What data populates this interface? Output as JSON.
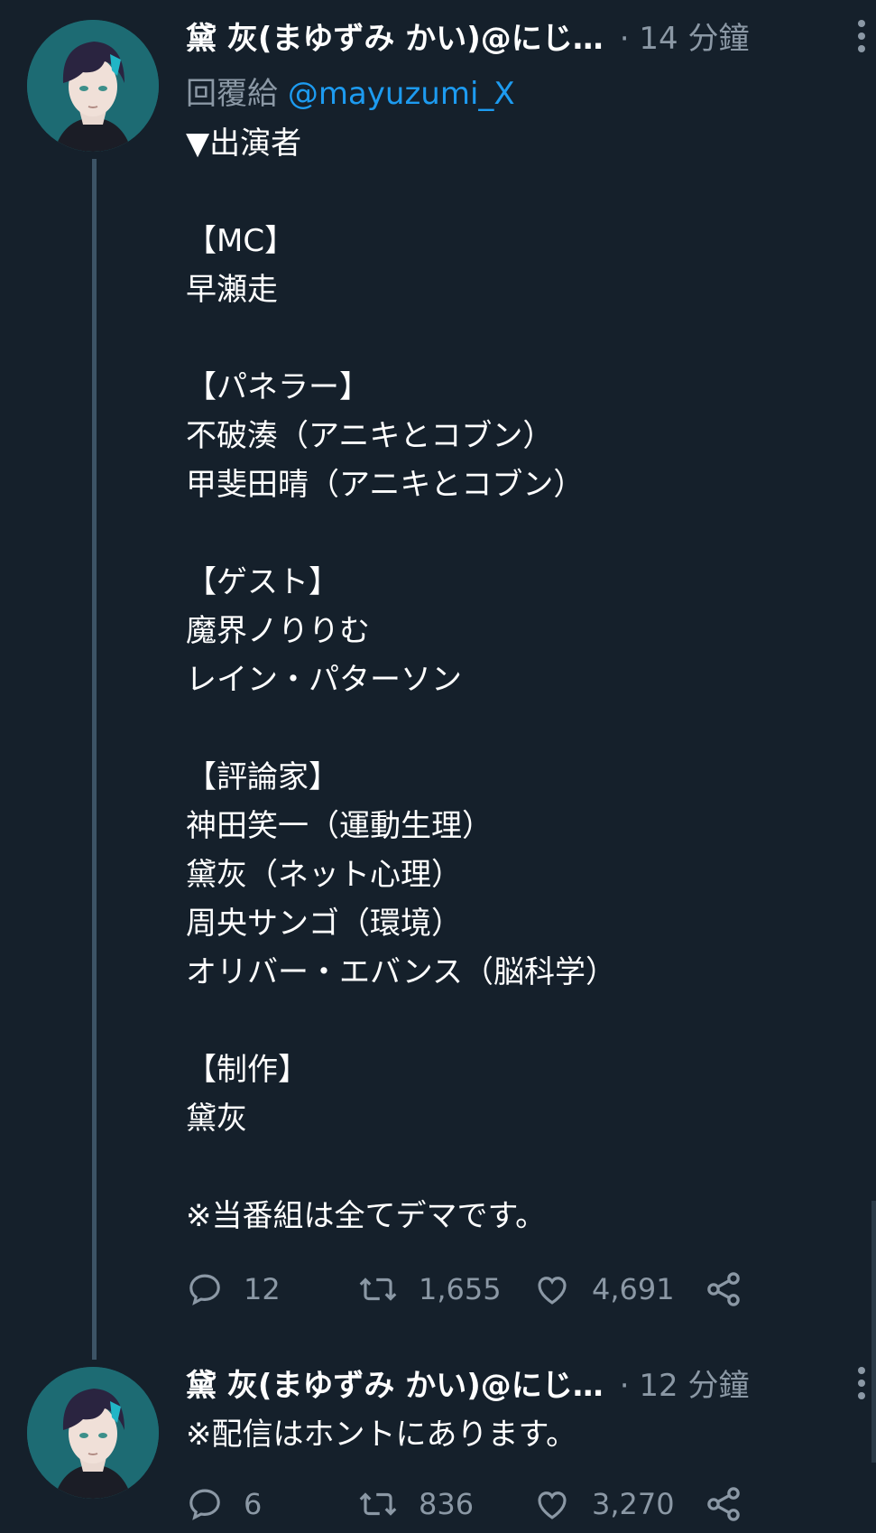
{
  "tweets": [
    {
      "author_name": "黛 灰(まゆずみ かい)@にじ…",
      "time": "· 14 分鐘",
      "reply_prefix": "回覆給",
      "reply_to": "@mayuzumi_X",
      "lines": [
        "▼出演者",
        "",
        "【MC】",
        "早瀬走",
        "",
        "【パネラー】",
        "不破湊（アニキとコブン）",
        "甲斐田晴（アニキとコブン）",
        "",
        "【ゲスト】",
        "魔界ノりりむ",
        "レイン・パターソン",
        "",
        "【評論家】",
        "神田笑一（運動生理）",
        "黛灰（ネット心理）",
        "周央サンゴ（環境）",
        "オリバー・エバンス（脳科学）",
        "",
        "【制作】",
        "黛灰",
        "",
        "※当番組は全てデマです。"
      ],
      "replies": "12",
      "retweets": "1,655",
      "likes": "4,691"
    },
    {
      "author_name": "黛 灰(まゆずみ かい)@にじ…",
      "time": "· 12 分鐘",
      "text": "※配信はホントにあります。",
      "replies": "6",
      "retweets": "836",
      "likes": "3,270"
    }
  ],
  "icons": {
    "reply": "comment-bubble-icon",
    "retweet": "retweet-icon",
    "like": "heart-icon",
    "share": "share-icon",
    "more": "more-vertical-icon"
  },
  "colors": {
    "background": "#15202b",
    "text": "#ffffff",
    "secondary": "#8b98a5",
    "mention": "#1d9bf0"
  }
}
